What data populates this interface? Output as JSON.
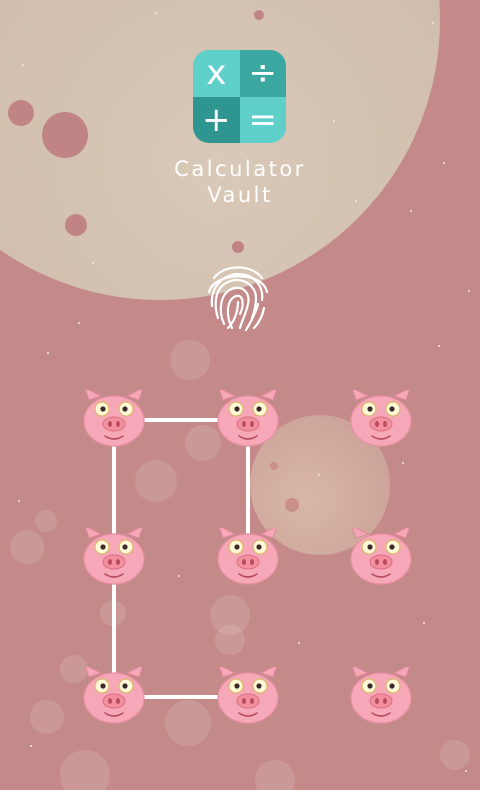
{
  "app": {
    "title_line1": "Calculator",
    "title_line2": "Vault",
    "icon_tiles": [
      {
        "symbol": "x",
        "color": "#5fcfc9"
      },
      {
        "symbol": "÷",
        "color": "#3aa7a1"
      },
      {
        "symbol": "+",
        "color": "#2e9590"
      },
      {
        "symbol": "=",
        "color": "#5fcfc9"
      }
    ]
  },
  "colors": {
    "background": "#c48a8a",
    "pattern_line": "#ffffff",
    "pig_face": "#f7a8b8"
  },
  "fingerprint": {
    "icon": "fingerprint-icon"
  },
  "pattern_lock": {
    "node_icon": "pig-face-icon",
    "rows": 3,
    "cols": 3,
    "selected_path": [
      5,
      2,
      1,
      4,
      7,
      8
    ]
  }
}
